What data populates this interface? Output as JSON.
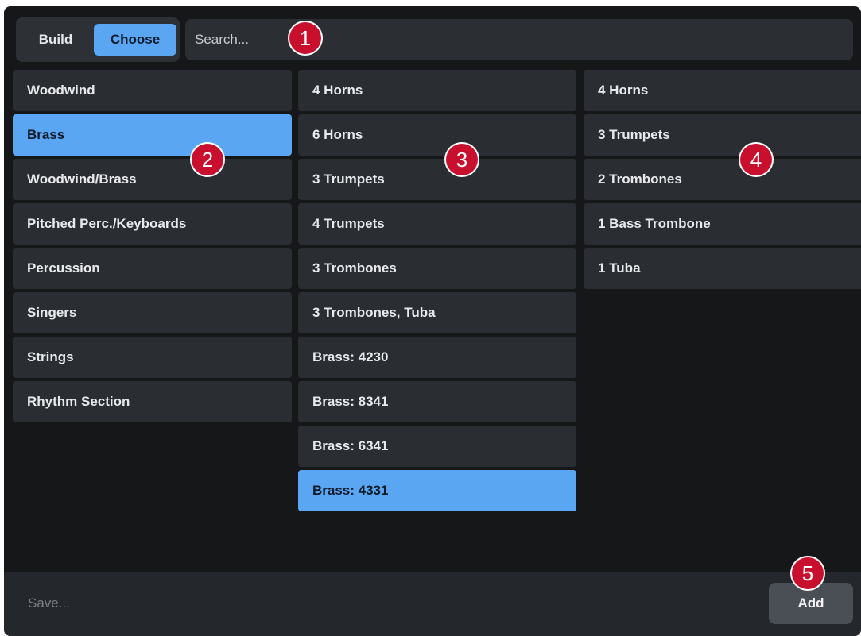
{
  "mode_toggle": {
    "build_label": "Build",
    "choose_label": "Choose"
  },
  "search": {
    "placeholder": "Search..."
  },
  "categories": [
    "Woodwind",
    "Brass",
    "Woodwind/Brass",
    "Pitched Perc./Keyboards",
    "Percussion",
    "Singers",
    "Strings",
    "Rhythm Section"
  ],
  "ensembles": [
    "4 Horns",
    "6 Horns",
    "3 Trumpets",
    "4 Trumpets",
    "3 Trombones",
    "3 Trombones, Tuba",
    "Brass: 4230",
    "Brass: 8341",
    "Brass: 6341",
    "Brass: 4331"
  ],
  "contents": [
    "4 Horns",
    "3 Trumpets",
    "2 Trombones",
    "1 Bass Trombone",
    "1 Tuba"
  ],
  "footer": {
    "save_label": "Save...",
    "add_label": "Add"
  },
  "callouts": [
    "1",
    "2",
    "3",
    "4",
    "5"
  ],
  "colors": {
    "selected": "#5aa6f2",
    "callout": "#c8102e",
    "background": "#161719"
  }
}
